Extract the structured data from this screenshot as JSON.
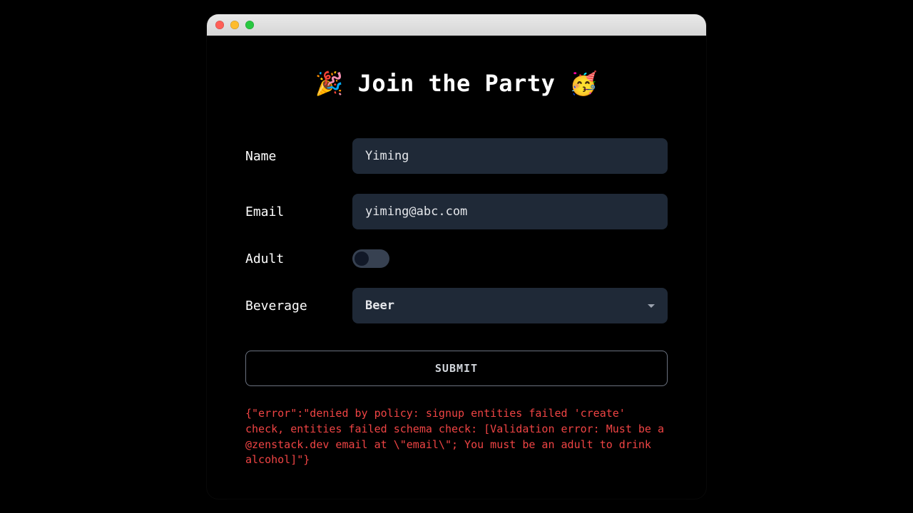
{
  "heading": "🎉 Join the Party 🥳",
  "form": {
    "name": {
      "label": "Name",
      "value": "Yiming"
    },
    "email": {
      "label": "Email",
      "value": "yiming@abc.com"
    },
    "adult": {
      "label": "Adult",
      "checked": false
    },
    "beverage": {
      "label": "Beverage",
      "value": "Beer"
    },
    "submit_label": "SUBMIT"
  },
  "error_text": "{\"error\":\"denied by policy: signup entities failed 'create' check, entities failed schema check: [Validation error: Must be a @zenstack.dev email at \\\"email\\\"; You must be an adult to drink alcohol]\"}"
}
